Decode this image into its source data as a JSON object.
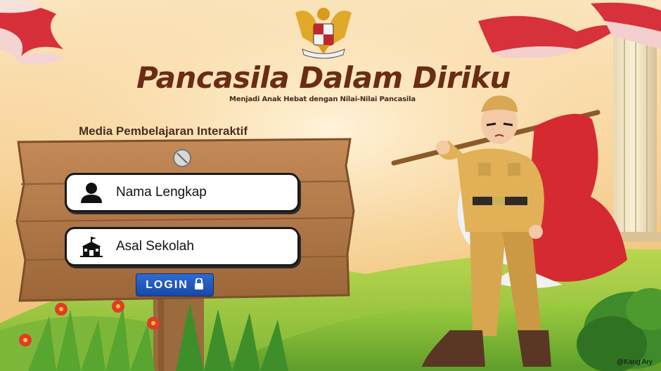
{
  "app": {
    "title": "Pancasila Dalam Diriku",
    "subtitle": "Menjadi Anak Hebat dengan Nilai-Nilai Pancasila",
    "media_label": "Media Pembelajaran Interaktif"
  },
  "form": {
    "name_field": {
      "text": "Nama Lengkap",
      "icon": "user-icon"
    },
    "school_field": {
      "text": "Asal Sekolah",
      "icon": "school-icon"
    },
    "login_label": "LOGIN",
    "login_icon": "lock-icon"
  },
  "credit": "@Kang Ary",
  "colors": {
    "title": "#6b2c14",
    "button": "#1f55bf",
    "flag_red": "#d3232a",
    "wood": "#b0784a"
  }
}
